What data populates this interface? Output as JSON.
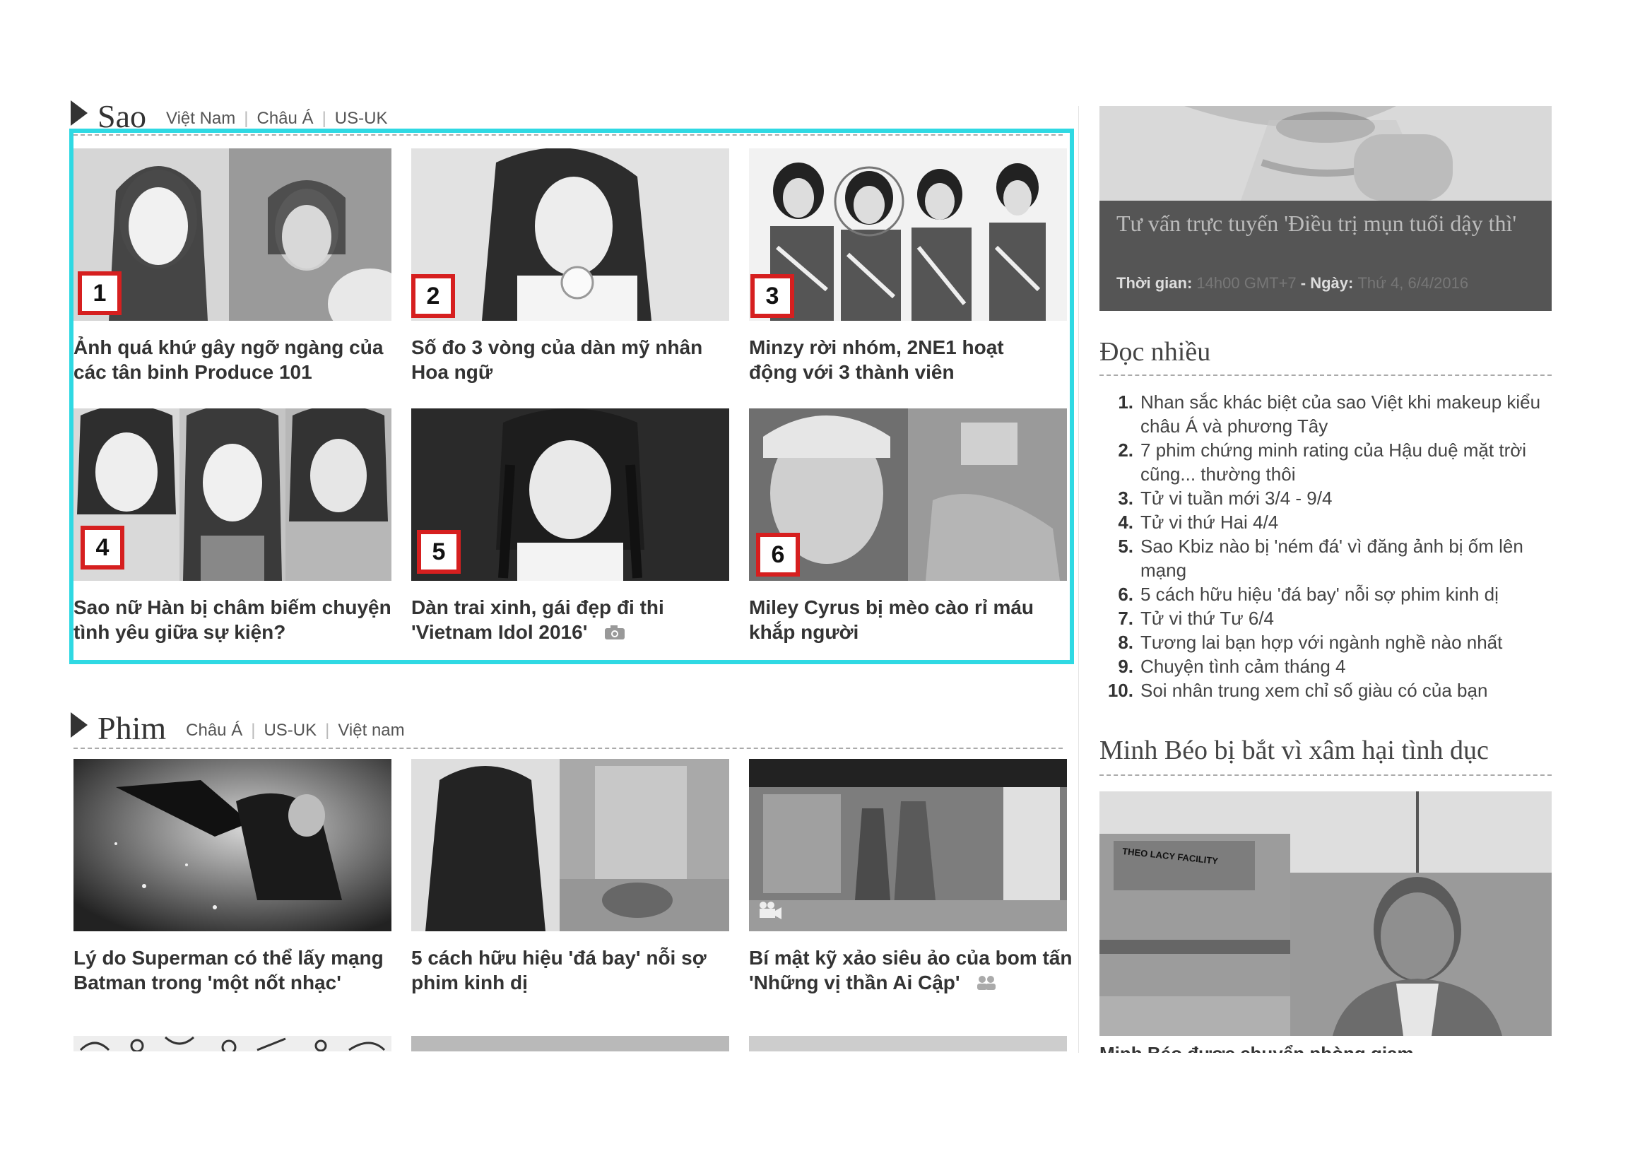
{
  "sao": {
    "title": "Sao",
    "links": [
      "Việt Nam",
      "Châu Á",
      "US-UK"
    ],
    "cards": [
      {
        "num": "1",
        "title": "Ảnh quá khứ gây ngỡ ngàng của các tân binh Produce 101"
      },
      {
        "num": "2",
        "title": "Số đo 3 vòng của dàn mỹ nhân Hoa ngữ"
      },
      {
        "num": "3",
        "title": "Minzy rời nhóm, 2NE1 hoạt động với 3 thành viên"
      },
      {
        "num": "4",
        "title": "Sao nữ Hàn bị châm biếm chuyện tình yêu giữa sự kiện?"
      },
      {
        "num": "5",
        "title": "Dàn trai xinh, gái đẹp đi thi 'Vietnam Idol 2016'"
      },
      {
        "num": "6",
        "title": "Miley Cyrus bị mèo cào rỉ máu khắp người"
      }
    ]
  },
  "phim": {
    "title": "Phim",
    "links": [
      "Châu Á",
      "US-UK",
      "Việt nam"
    ],
    "cards": [
      {
        "title": "Lý do Superman có thể lấy mạng Batman trong 'một nốt nhạc'"
      },
      {
        "title": "5 cách hữu hiệu 'đá bay' nỗi sợ phim kinh dị"
      },
      {
        "title": "Bí mật kỹ xảo siêu ảo của bom tấn 'Những vị thần Ai Cập'"
      }
    ]
  },
  "promo": {
    "title": "Tư vấn trực tuyến 'Điều trị mụn tuổi dậy thì'",
    "time_label": "Thời gian:",
    "time_value": "14h00 GMT+7",
    "date_label": "- Ngày:",
    "date_value": "Thứ 4, 6/4/2016"
  },
  "doc_nhieu": {
    "title": "Đọc nhiều",
    "items": [
      {
        "n": "1.",
        "t": "Nhan sắc khác biệt của sao Việt khi makeup kiểu châu Á và phương Tây"
      },
      {
        "n": "2.",
        "t": "7 phim chứng minh rating của Hậu duệ mặt trời cũng... thường thôi"
      },
      {
        "n": "3.",
        "t": "Tử vi tuần mới 3/4 - 9/4"
      },
      {
        "n": "4.",
        "t": "Tử vi thứ Hai 4/4"
      },
      {
        "n": "5.",
        "t": "Sao Kbiz nào bị 'ném đá' vì đăng ảnh bị ốm lên mạng"
      },
      {
        "n": "6.",
        "t": "5 cách hữu hiệu 'đá bay' nỗi sợ phim kinh dị"
      },
      {
        "n": "7.",
        "t": "Tử vi thứ Tư 6/4"
      },
      {
        "n": "8.",
        "t": "Tương lai bạn hợp với ngành nghề nào nhất"
      },
      {
        "n": "9.",
        "t": "Chuyện tình cảm tháng 4"
      },
      {
        "n": "10.",
        "t": "Soi nhân trung xem chỉ số giàu có của bạn"
      }
    ]
  },
  "minh_beo": {
    "title": "Minh Béo bị bắt vì xâm hại tình dục",
    "sign_text": "THEO LACY FACILITY",
    "caption": "Minh Béo được chuyển phòng giam"
  },
  "colors": {
    "highlight": "#2fd9e3",
    "badge_border": "#d61f1f"
  },
  "icons": {
    "photo": "camera-icon",
    "video": "video-camera-icon",
    "gallery": "people-icon"
  }
}
